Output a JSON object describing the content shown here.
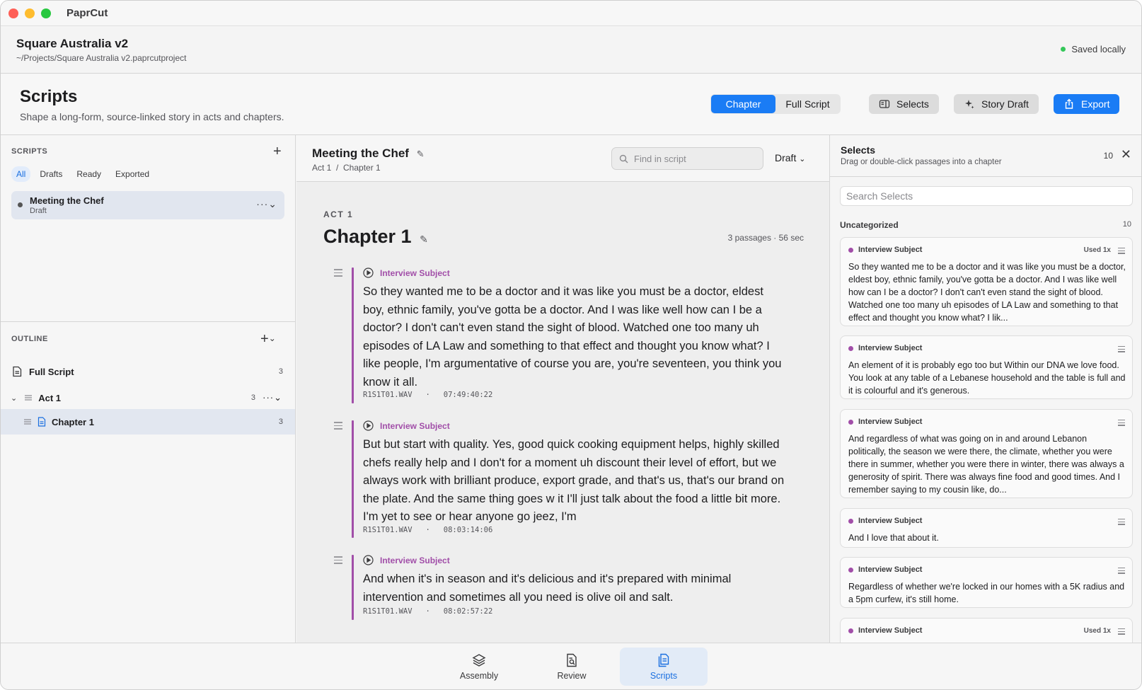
{
  "app": {
    "title": "PaprCut"
  },
  "project": {
    "name": "Square Australia v2",
    "path": "~/Projects/Square Australia v2.paprcutproject",
    "save_status": "Saved locally"
  },
  "page": {
    "title": "Scripts",
    "subtitle": "Shape a long-form, source-linked story in acts and chapters."
  },
  "toolbar": {
    "view_modes": [
      {
        "label": "Chapter",
        "active": true
      },
      {
        "label": "Full Script",
        "active": false
      }
    ],
    "selects_label": "Selects",
    "story_draft_label": "Story Draft",
    "export_label": "Export"
  },
  "sidebar": {
    "scripts_label": "SCRIPTS",
    "filters": [
      {
        "label": "All",
        "active": true
      },
      {
        "label": "Drafts"
      },
      {
        "label": "Ready"
      },
      {
        "label": "Exported"
      }
    ],
    "scripts": [
      {
        "name": "Meeting the Chef",
        "status": "Draft"
      }
    ],
    "outline_label": "OUTLINE",
    "outline": {
      "full_script": {
        "label": "Full Script",
        "count": "3"
      },
      "act": {
        "label": "Act 1",
        "count": "3"
      },
      "chapter": {
        "label": "Chapter 1",
        "count": "3"
      }
    }
  },
  "editor": {
    "title": "Meeting the Chef",
    "breadcrumb": "Act 1  /  Chapter 1",
    "find_placeholder": "Find in script",
    "status_select": "Draft",
    "act_label": "ACT 1",
    "chapter_title": "Chapter 1",
    "chapter_meta": "3 passages · 56 sec",
    "passages": [
      {
        "speaker": "Interview Subject",
        "text": "So they wanted me to be a doctor and it was like you must be a doctor, eldest boy, ethnic family, you've gotta be a doctor. And I was like well how can I be a doctor? I don't can't even stand the sight of blood. Watched one too many uh episodes of LA Law and something to that effect and thought you know what? I like people, I'm argumentative of course you are, you're seventeen, you think you know it all.",
        "source": "R1S1T01.WAV   ·   07:49:40:22"
      },
      {
        "speaker": "Interview Subject",
        "text": "But but start with quality. Yes, good quick cooking equipment helps, highly skilled chefs really help and I don't for a moment uh discount their level of effort, but we always work with brilliant produce, export grade, and that's us, that's our brand on the plate. And the same thing goes w it I'll just talk about the food a little bit more. I'm yet to see or hear anyone go jeez, I'm",
        "source": "R1S1T01.WAV   ·   08:03:14:06"
      },
      {
        "speaker": "Interview Subject",
        "text": "And when it's in season and it's delicious and it's prepared with minimal intervention and sometimes all you need is olive oil and salt.",
        "source": "R1S1T01.WAV   ·   08:02:57:22"
      }
    ]
  },
  "selects": {
    "title": "Selects",
    "subtitle": "Drag or double-click passages into a chapter",
    "count": "10",
    "search_placeholder": "Search Selects",
    "group_label": "Uncategorized",
    "group_count": "10",
    "cards": [
      {
        "speaker": "Interview Subject",
        "used": "Used 1x",
        "text": "So they wanted me to be a doctor and it was like you must be a doctor, eldest boy, ethnic family, you've gotta be a doctor. And I was like well how can I be a doctor? I don't can't even stand the sight of blood. Watched one too many uh episodes of LA Law and something to that effect and thought you know what? I lik..."
      },
      {
        "speaker": "Interview Subject",
        "used": "",
        "text": "An element of it is probably ego too but Within our DNA we love food. You look at any table of a Lebanese household and the table is full and it is colourful and it's generous."
      },
      {
        "speaker": "Interview Subject",
        "used": "",
        "text": "And regardless of what was going on in and around Lebanon politically, the season we were there, the climate, whether you were there in summer, whether you were there in winter, there was always a generosity of spirit. There was always fine food and good times. And I remember saying to my cousin like, do..."
      },
      {
        "speaker": "Interview Subject",
        "used": "",
        "text": "And I love that about it."
      },
      {
        "speaker": "Interview Subject",
        "used": "",
        "text": "Regardless of whether we're locked in our homes with a 5K radius and a 5pm curfew, it's still home."
      },
      {
        "speaker": "Interview Subject",
        "used": "Used 1x",
        "text": ""
      }
    ]
  },
  "tabs": [
    {
      "label": "Assembly",
      "icon": "layers-icon",
      "active": false
    },
    {
      "label": "Review",
      "icon": "document-search-icon",
      "active": false
    },
    {
      "label": "Scripts",
      "icon": "scripts-icon",
      "active": true
    }
  ]
}
